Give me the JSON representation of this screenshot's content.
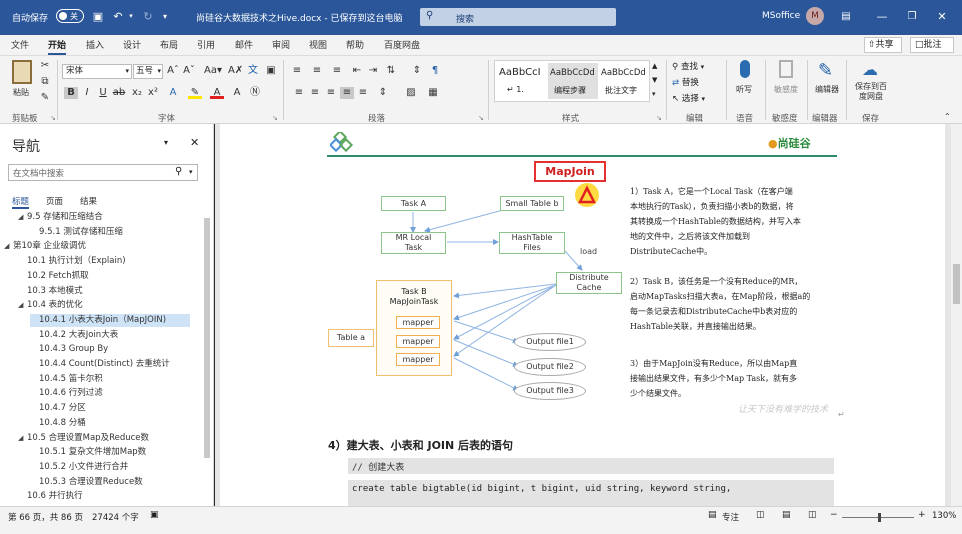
{
  "titlebar": {
    "autosave_label": "自动保存",
    "autosave_state": "关",
    "doc_title": "尚硅谷大数据技术之Hive.docx  -  已保存到这台电脑",
    "search_placeholder": "搜索",
    "account_name": "MSoffice",
    "account_initial": "M"
  },
  "menu": {
    "tabs": [
      "文件",
      "开始",
      "插入",
      "设计",
      "布局",
      "引用",
      "邮件",
      "审阅",
      "视图",
      "帮助",
      "百度网盘"
    ],
    "share_label": "共享",
    "comments_label": "批注"
  },
  "ribbon": {
    "paste_label": "粘贴",
    "clipboard_group": "剪贴板",
    "font_name": "宋体",
    "font_size": "五号",
    "font_group": "字体",
    "paragraph_group": "段落",
    "styles": [
      {
        "preview": "AaBbCcI",
        "label": "↵ 1."
      },
      {
        "preview": "AaBbCcDd",
        "label": "编程步骤"
      },
      {
        "preview": "AaBbCcDd",
        "label": "批注文字"
      }
    ],
    "styles_group": "样式",
    "find_label": "查找",
    "replace_label": "替换",
    "select_label": "选择",
    "editing_group": "编辑",
    "dictate_label": "听写",
    "voice_group": "语音",
    "sensitivity_label": "敏感度",
    "sensitivity_group": "敏感度",
    "editor_label": "编辑器",
    "editor_group": "编辑器",
    "save_baidu_label": "保存到百度网盘",
    "save_group": "保存"
  },
  "nav": {
    "title": "导航",
    "search_placeholder": "在文档中搜索",
    "tabs": [
      "标题",
      "页面",
      "结果"
    ],
    "items": [
      {
        "text": "9.5 存储和压缩结合",
        "level": 2,
        "expander": "◢"
      },
      {
        "text": "9.5.1 测试存储和压缩",
        "level": 3,
        "expander": ""
      },
      {
        "text": "第10章 企业级调优",
        "level": 1,
        "expander": "◢"
      },
      {
        "text": "10.1 执行计划（Explain)",
        "level": 2,
        "expander": ""
      },
      {
        "text": "10.2 Fetch抓取",
        "level": 2,
        "expander": ""
      },
      {
        "text": "10.3 本地模式",
        "level": 2,
        "expander": ""
      },
      {
        "text": "10.4 表的优化",
        "level": 2,
        "expander": "◢"
      },
      {
        "text": "10.4.1 小表大表Join（MapJOIN)",
        "level": 3,
        "expander": "",
        "selected": true
      },
      {
        "text": "10.4.2 大表Join大表",
        "level": 3,
        "expander": ""
      },
      {
        "text": "10.4.3 Group By",
        "level": 3,
        "expander": ""
      },
      {
        "text": "10.4.4 Count(Distinct) 去重统计",
        "level": 3,
        "expander": ""
      },
      {
        "text": "10.4.5 笛卡尔积",
        "level": 3,
        "expander": ""
      },
      {
        "text": "10.4.6 行列过滤",
        "level": 3,
        "expander": ""
      },
      {
        "text": "10.4.7 分区",
        "level": 3,
        "expander": ""
      },
      {
        "text": "10.4.8 分桶",
        "level": 3,
        "expander": ""
      },
      {
        "text": "10.5 合理设置Map及Reduce数",
        "level": 2,
        "expander": "◢"
      },
      {
        "text": "10.5.1 复杂文件增加Map数",
        "level": 3,
        "expander": ""
      },
      {
        "text": "10.5.2 小文件进行合并",
        "level": 3,
        "expander": ""
      },
      {
        "text": "10.5.3 合理设置Reduce数",
        "level": 3,
        "expander": ""
      },
      {
        "text": "10.6 并行执行",
        "level": 2,
        "expander": ""
      }
    ]
  },
  "doc": {
    "logo_text": "尚硅谷",
    "diagram_title": "MapJoin",
    "nodes": {
      "task_a": "Task A",
      "small_table": "Small Table b",
      "mr_local_1": "MR Local",
      "mr_local_2": "Task",
      "hash_table_1": "HashTable",
      "hash_table_2": "Files",
      "load": "load",
      "distribute_1": "Distribute",
      "distribute_2": "Cache",
      "task_b_1": "Task B",
      "task_b_2": "MapJoinTask",
      "table_a": "Table a",
      "mapper": "mapper",
      "output1": "Output file1",
      "output2": "Output file2",
      "output3": "Output file3"
    },
    "para1": [
      "1）Task A，它是一个Local Task（在客户端",
      "本地执行的Task），负责扫描小表b的数据，将",
      "其转换成一个HashTable的数据结构，并写入本",
      "地的文件中，之后将该文件加载到",
      "DistributeCache中。"
    ],
    "para2": [
      "2）Task B，该任务是一个没有Reduce的MR，",
      "启动MapTasks扫描大表a，在Map阶段，根据a的",
      "每一条记录去和DistributeCache中b表对应的",
      "HashTable关联，并直接输出结果。"
    ],
    "para3": [
      "3）由于MapJoin没有Reduce，所以由Map直",
      "接输出结果文件，有多少个Map Task，就有多",
      "少个结果文件。"
    ],
    "watermark": "让天下没有难学的技术",
    "heading": "4）建大表、小表和 JOIN 后表的语句",
    "code_comment": "// 创建大表",
    "code_line": "create table bigtable(id bigint, t bigint, uid string, keyword string,"
  },
  "status": {
    "page": "第 66 页，共 86 页",
    "words": "27424 个字",
    "focus": "专注",
    "zoom": "130%"
  }
}
